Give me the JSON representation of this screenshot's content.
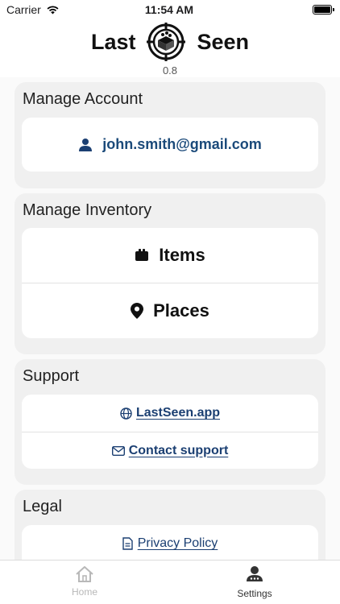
{
  "status_bar": {
    "carrier": "Carrier",
    "time": "11:54 AM"
  },
  "header": {
    "title_left": "Last",
    "title_right": "Seen",
    "version": "0.8"
  },
  "sections": {
    "account": {
      "title": "Manage Account",
      "email": "john.smith@gmail.com"
    },
    "inventory": {
      "title": "Manage Inventory",
      "items_label": "Items",
      "places_label": "Places"
    },
    "support": {
      "title": "Support",
      "website_label": "LastSeen.app",
      "contact_label": "Contact support"
    },
    "legal": {
      "title": "Legal",
      "privacy_label": "Privacy Policy"
    }
  },
  "tabs": {
    "home_label": "Home",
    "settings_label": "Settings"
  },
  "colors": {
    "accent": "#1b3f72",
    "inactive_tab": "#b8b8b8"
  }
}
